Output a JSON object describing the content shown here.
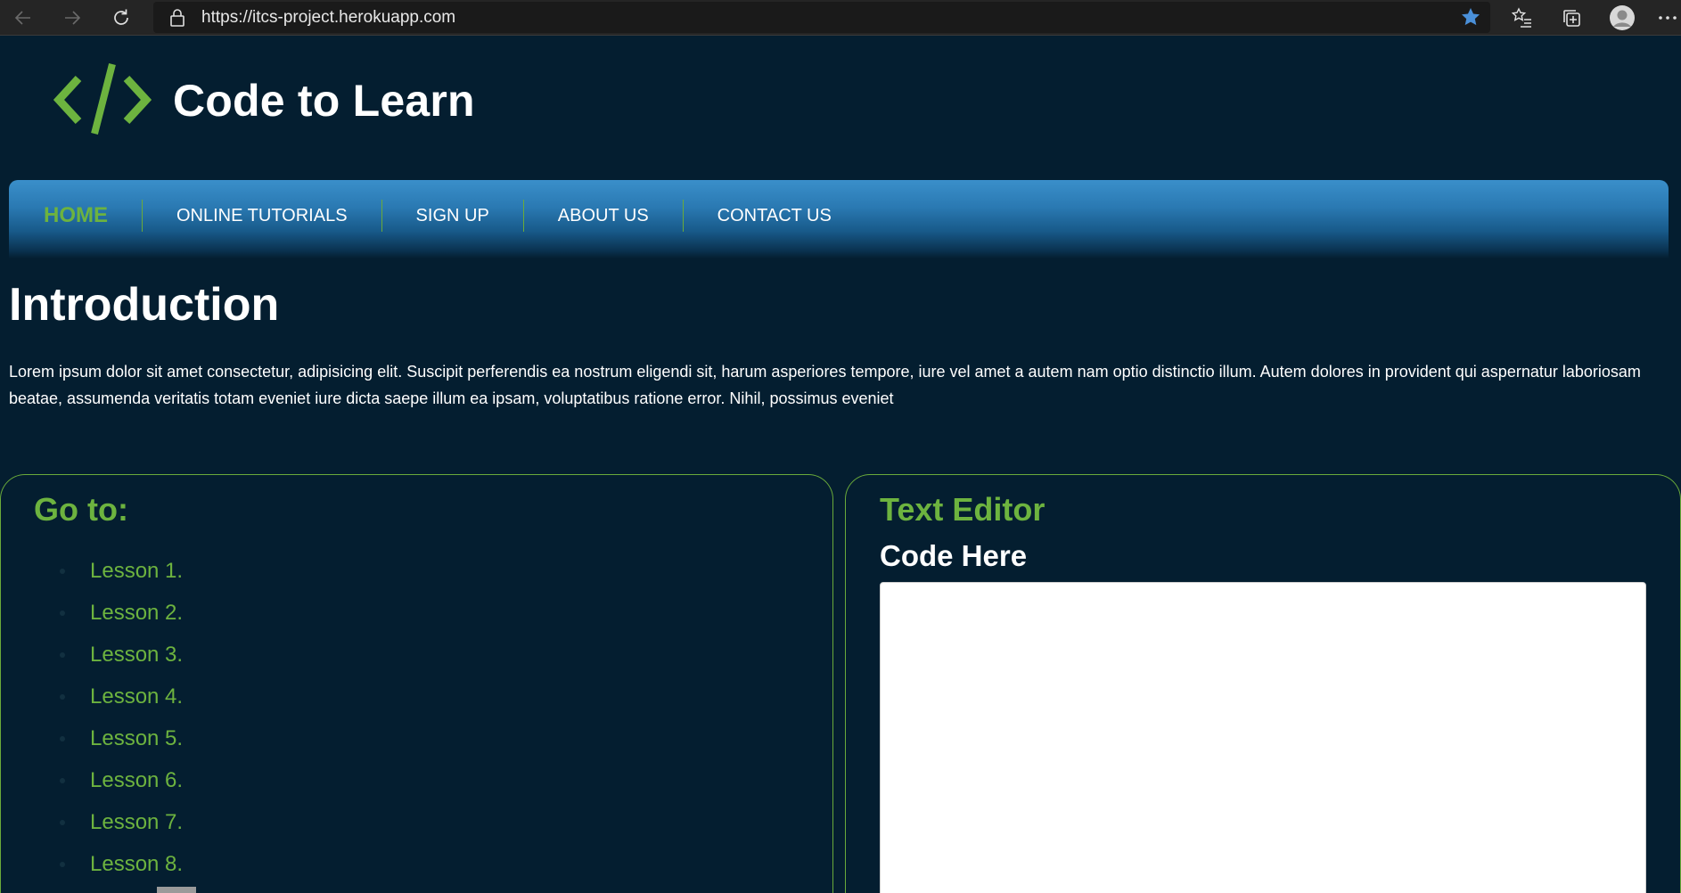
{
  "browser": {
    "url": "https://itcs-project.herokuapp.com",
    "icons": [
      "back-icon",
      "forward-icon",
      "refresh-icon",
      "lock-icon",
      "favorite-star-icon",
      "favorites-list-icon",
      "collections-icon",
      "profile-icon",
      "more-icon"
    ],
    "star_color": "#4a90d9"
  },
  "header": {
    "logo_icon": "code-brackets-icon",
    "title": "Code to Learn"
  },
  "nav": {
    "items": [
      {
        "label": "HOME",
        "active": true
      },
      {
        "label": "ONLINE TUTORIALS",
        "active": false
      },
      {
        "label": "SIGN UP",
        "active": false
      },
      {
        "label": "ABOUT US",
        "active": false
      },
      {
        "label": "CONTACT US",
        "active": false
      }
    ]
  },
  "intro": {
    "title": "Introduction",
    "text": "Lorem ipsum dolor sit amet consectetur, adipisicing elit. Suscipit perferendis ea nostrum eligendi sit, harum asperiores tempore, iure vel amet a autem nam optio distinctio illum. Autem dolores in provident qui aspernatur laboriosam beatae, assumenda veritatis totam eveniet iure dicta saepe illum ea ipsam, voluptatibus ratione error. Nihil, possimus eveniet"
  },
  "goto": {
    "title": "Go to:",
    "lessons": [
      "Lesson 1.",
      "Lesson 2.",
      "Lesson 3.",
      "Lesson 4.",
      "Lesson 5.",
      "Lesson 6.",
      "Lesson 7.",
      "Lesson 8."
    ]
  },
  "editor": {
    "title": "Text Editor",
    "label": "Code Here",
    "value": ""
  },
  "colors": {
    "background": "#041e30",
    "accent_green": "#6db33f",
    "nav_blue": "#2a79b2"
  }
}
